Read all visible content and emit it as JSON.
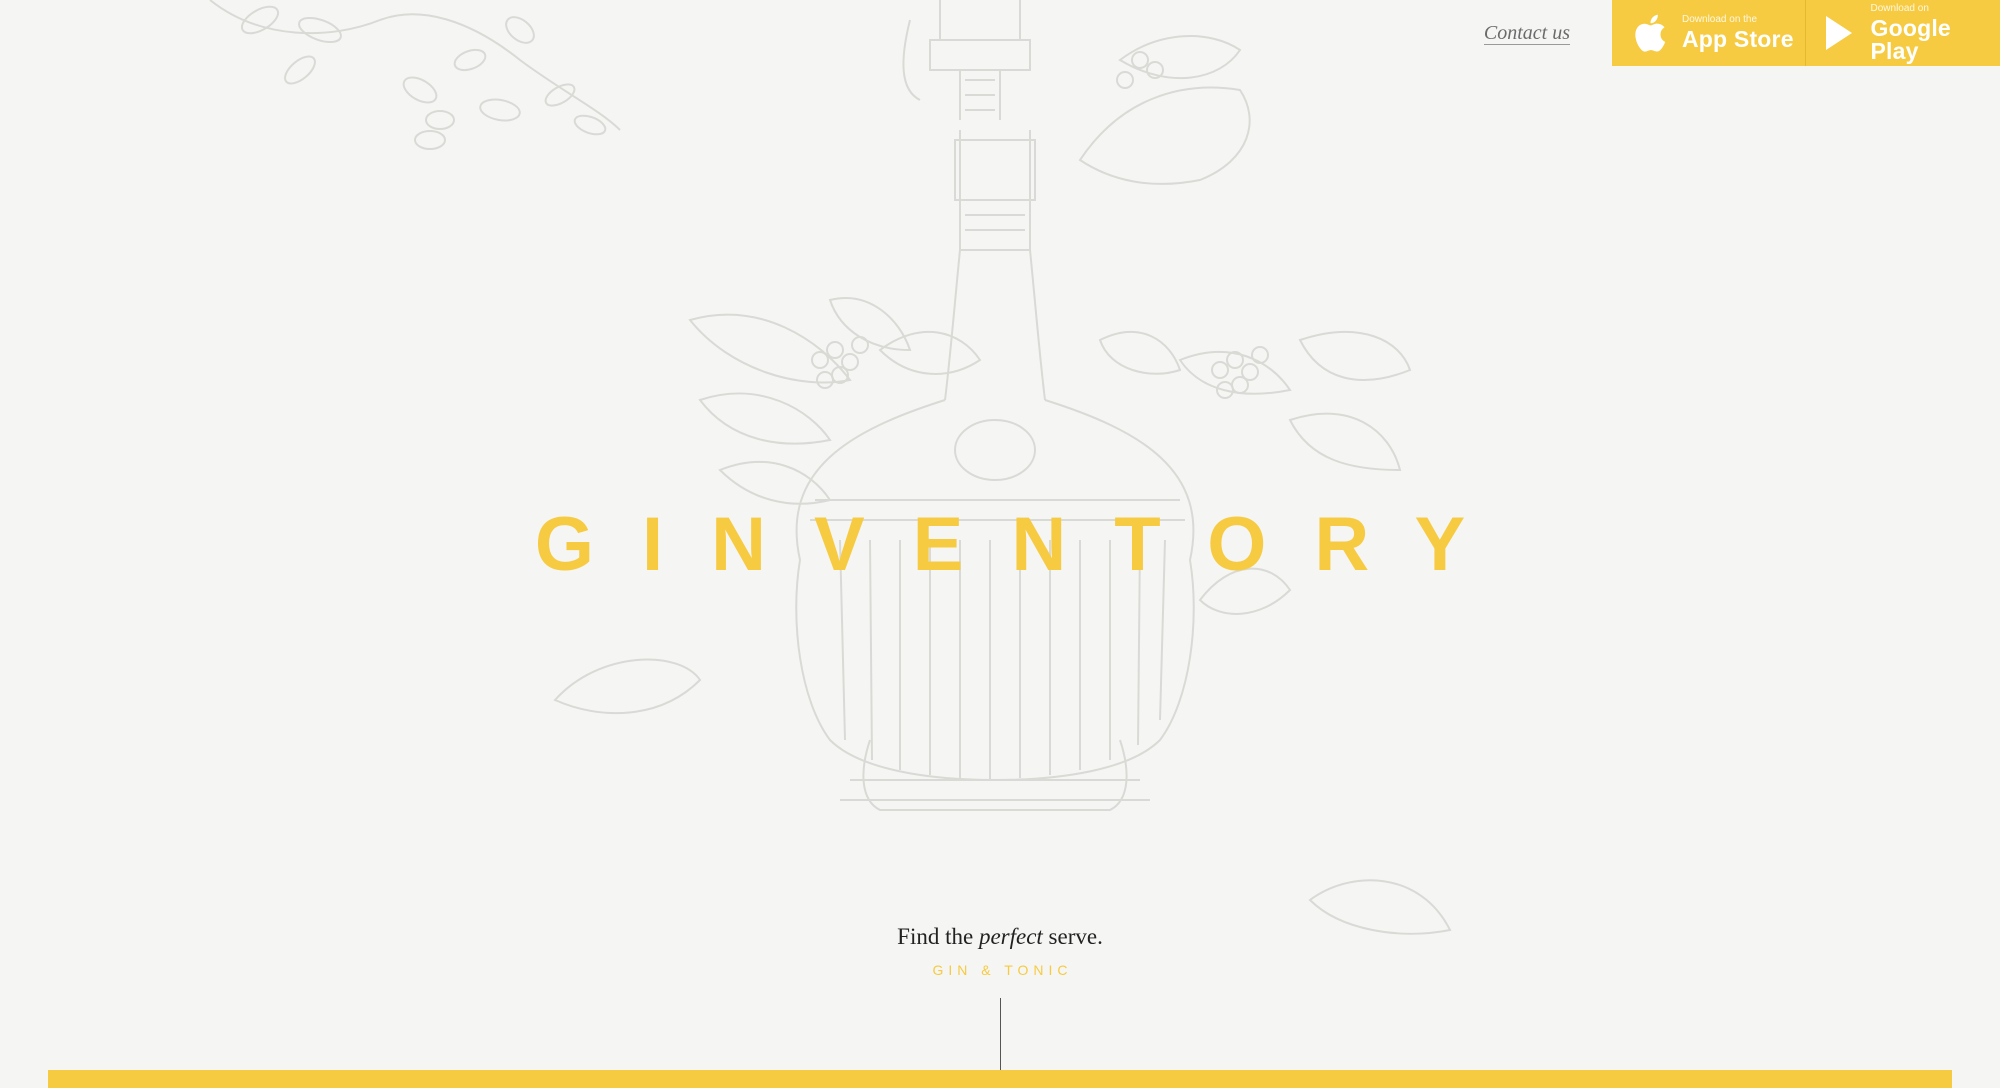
{
  "header": {
    "contact_label": "Contact us",
    "app_store": {
      "small_label": "Download on the",
      "big_label": "App Store",
      "icon": "apple-icon"
    },
    "google_play": {
      "small_label": "Download on",
      "big_label": "Google Play",
      "icon": "play-icon"
    }
  },
  "hero": {
    "brand": "GINVENTORY",
    "tagline_pre": "Find the ",
    "tagline_em": "perfect",
    "tagline_post": " serve.",
    "subtag": "GIN & TONIC"
  },
  "colors": {
    "accent": "#f6cb42",
    "background": "#f5f5f3",
    "illustration": "#dcdcd8"
  }
}
